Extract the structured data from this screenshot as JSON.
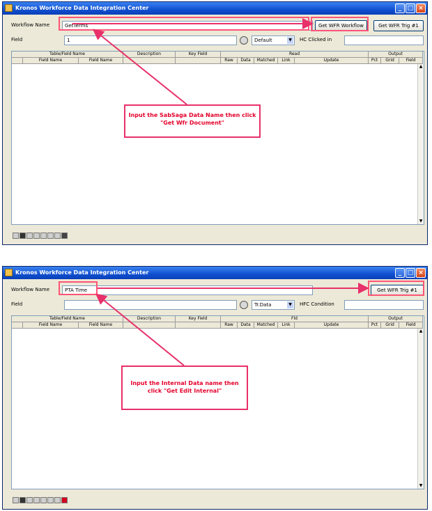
{
  "window1": {
    "title": "Kronos Workforce Data Integration Center",
    "ws_label": "Workflow Name",
    "ws_value": "GetTerms",
    "btn_primary": "Get WFR Workflow",
    "btn_secondary": "Get WFR Trig #1",
    "row2_label": "Field",
    "row2_value": "1",
    "row2_dropdown": "Default",
    "row2_right_label": "HC Clicked in",
    "headers_top": [
      "Table/Field Name",
      "Description",
      "Key Field",
      "Read",
      "Output"
    ],
    "headers_sub": [
      "",
      "Field Name",
      "Field Name",
      "Raw",
      "Data",
      "Matched",
      "Link",
      "Update",
      "Pct",
      "Grid",
      "Field"
    ],
    "note": "Input the SabSaga Data Name then click \"Get Wfr Document\""
  },
  "window2": {
    "title": "Kronos Workforce Data Integration Center",
    "ws_label": "Workflow Name",
    "ws_value": "PTA Time",
    "btn_primary": "Get WFR Trig #1",
    "row2_label": "Field",
    "row2_value": "",
    "row2_dropdown": "Tr.Data",
    "row2_right_label": "HFC Condition",
    "headers_top": [
      "Table/Field Name",
      "Description",
      "Key Field",
      "Fld",
      "Output"
    ],
    "headers_sub": [
      "",
      "Field Name",
      "Field Name",
      "Raw",
      "Data",
      "Matched",
      "Link",
      "Update",
      "Pct",
      "Grid",
      "Field"
    ],
    "note": "Input the Internal Data name then click \"Get Edit Internal\""
  },
  "colors": {
    "title_bar": "#1150d0",
    "annotation": "#e8306a",
    "window_bg": "#ece9d8"
  },
  "icons": [
    "app-icon",
    "minimize-icon",
    "maximize-icon",
    "close-icon",
    "refresh-icon",
    "scroll-up-icon",
    "scroll-down-icon"
  ]
}
